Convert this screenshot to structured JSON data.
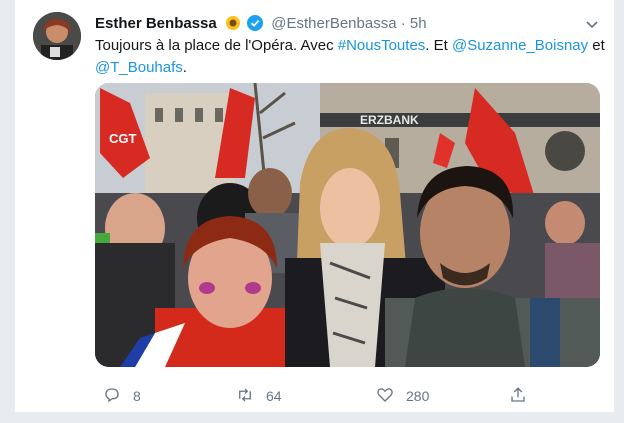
{
  "tweet": {
    "author_name": "Esther Benbassa",
    "author_handle": "@EstherBenbassa",
    "separator": "·",
    "time": "5h",
    "text_before": "Toujours à la place de l'Opéra. Avec ",
    "hashtag": "#NousToutes",
    "text_mid": ". Et ",
    "mention1": "@Suzanne_Boisnay",
    "text_and": " et ",
    "mention2": "@T_Bouhafs",
    "text_end": ".",
    "photo_sign_text": "ERZBANK",
    "flag_text": "CGT"
  },
  "actions": {
    "replies": "8",
    "retweets": "64",
    "likes": "280"
  },
  "colors": {
    "link": "#1b95e0",
    "muted": "#657786",
    "verified": "#1da1f2"
  }
}
